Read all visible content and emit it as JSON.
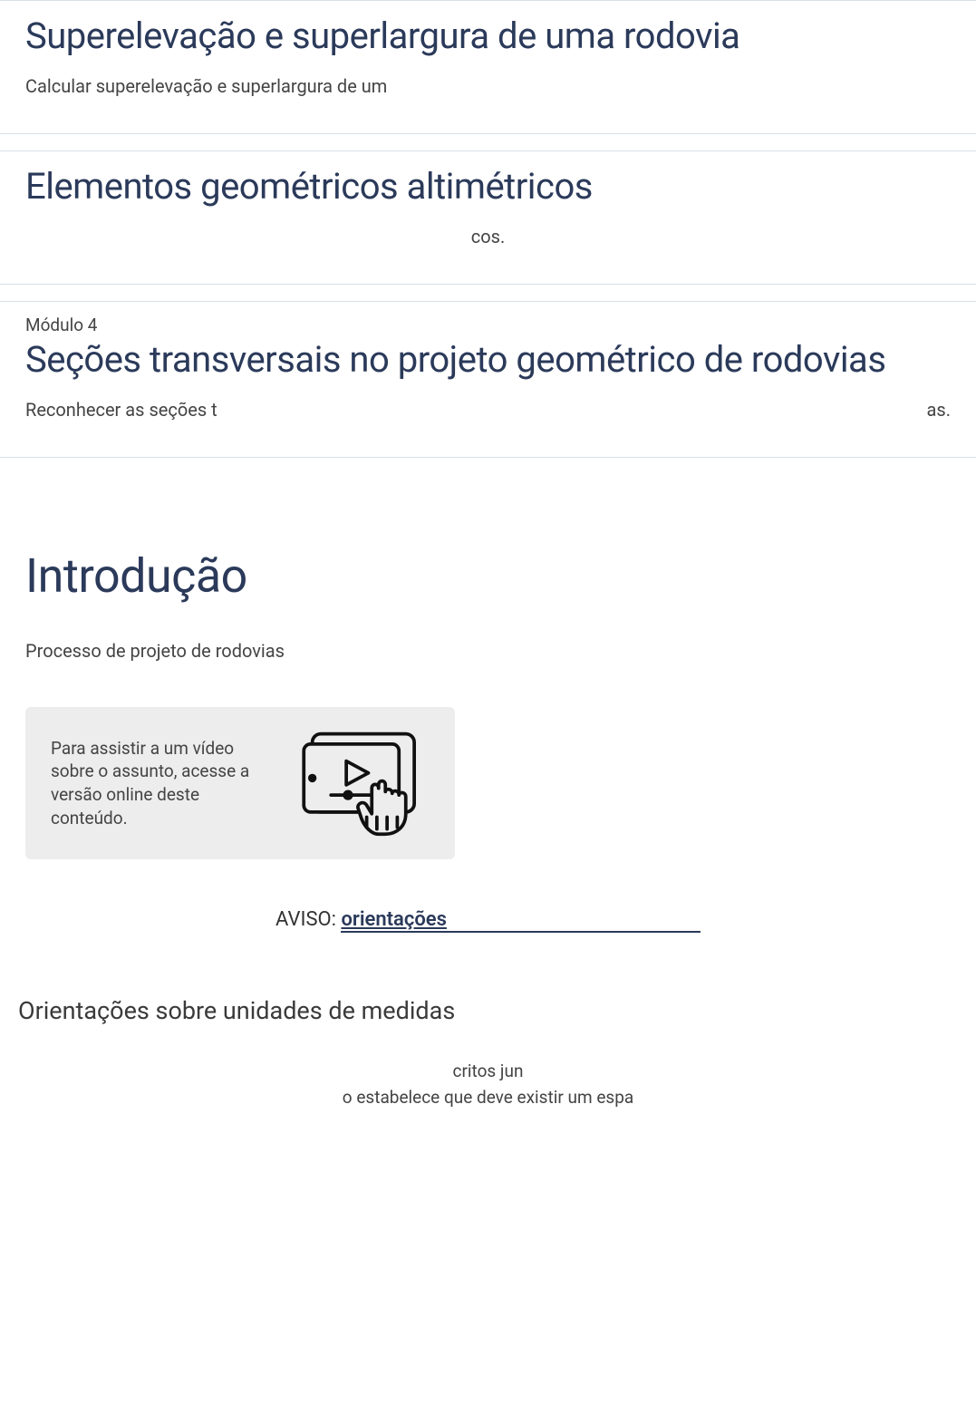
{
  "modules": [
    {
      "title": "Superelevação e superlargura de uma rodovia",
      "desc_left": "Calcular superelevação e superlargura de um",
      "desc_right": ""
    },
    {
      "title": "Elementos geométricos altimétricos",
      "desc_center": "cos."
    },
    {
      "label": "Módulo 4",
      "title": "Seções transversais no projeto geométrico de rodovias",
      "desc_left": "Reconhecer as seções t",
      "desc_right": "as."
    }
  ],
  "intro": {
    "heading": "Introdução",
    "subheading": "Processo de projeto de rodovias",
    "video_notice": "Para assistir a um vídeo sobre o assunto, acesse a versão online deste conteúdo.",
    "aviso_label": "AVISO: ",
    "aviso_link": "orientações"
  },
  "orient": {
    "title": "Orientações sobre unidades de medidas",
    "line1": "critos jun",
    "line2": "o estabelece que deve existir um espa"
  }
}
